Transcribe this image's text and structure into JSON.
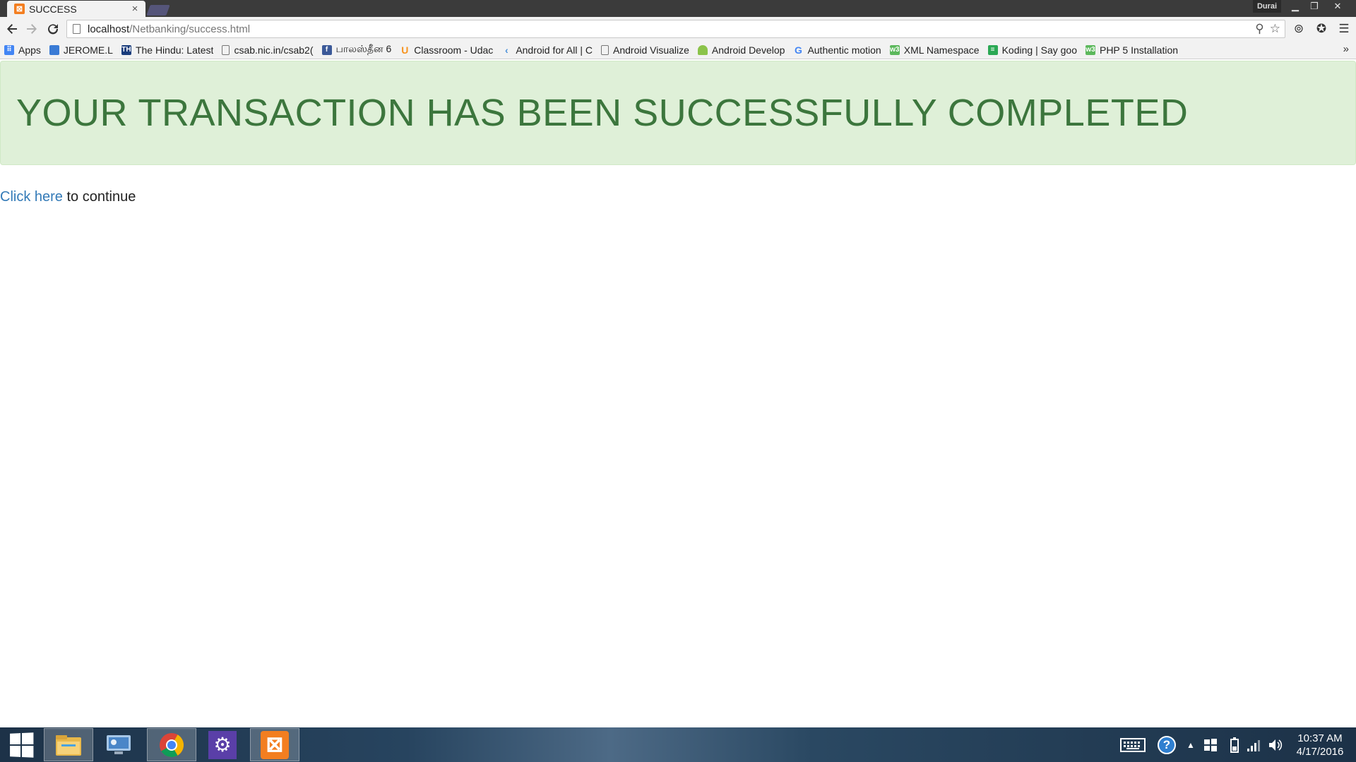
{
  "browser": {
    "tab_title": "SUCCESS",
    "tab_close": "×",
    "profile_name": "Durai",
    "url_host": "localhost",
    "url_path": "/Netbanking/success.html"
  },
  "bookmarks": [
    {
      "label": "Apps",
      "icon": "apps-grid-icon",
      "color": "#4285f4"
    },
    {
      "label": "JEROME.L",
      "icon": "calendar-icon",
      "color": "#3a7bd5"
    },
    {
      "label": "The Hindu: Latest",
      "icon": "the-hindu-icon",
      "color": "#1a3d7c"
    },
    {
      "label": "csab.nic.in/csab2(",
      "icon": "page-icon",
      "color": "#777777"
    },
    {
      "label": "பாலஸ்தீன 6",
      "icon": "facebook-icon",
      "color": "#3b5998"
    },
    {
      "label": "Classroom - Udac",
      "icon": "udacity-icon",
      "color": "#f7931e"
    },
    {
      "label": "Android for All | C",
      "icon": "android-for-all-icon",
      "color": "#4a90d9"
    },
    {
      "label": "Android Visualize",
      "icon": "page-icon",
      "color": "#777777"
    },
    {
      "label": "Android Develop",
      "icon": "android-icon",
      "color": "#8bc34a"
    },
    {
      "label": "Authentic motion",
      "icon": "google-icon",
      "color": "#4285f4"
    },
    {
      "label": "XML Namespace",
      "icon": "w3schools-icon",
      "color": "#5cb85c"
    },
    {
      "label": "Koding | Say goo",
      "icon": "koding-icon",
      "color": "#2ba854"
    },
    {
      "label": "PHP 5 Installation",
      "icon": "w3schools-icon",
      "color": "#5cb85c"
    }
  ],
  "page": {
    "heading": "YOUR TRANSACTION HAS BEEN SUCCESSFULLY COMPLETED",
    "link_text": "Click here",
    "after_link_text": " to continue"
  },
  "taskbar": {
    "apps": [
      {
        "name": "file-explorer-icon",
        "active": true
      },
      {
        "name": "computer-management-icon",
        "active": false
      },
      {
        "name": "chrome-icon",
        "active": true
      },
      {
        "name": "settings-gear-icon",
        "active": false
      },
      {
        "name": "xampp-icon",
        "active": true
      }
    ],
    "time": "10:37 AM",
    "date": "4/17/2016"
  },
  "colors": {
    "alert_bg": "#dff0d8",
    "alert_text": "#3c763d",
    "link": "#337ab7"
  }
}
